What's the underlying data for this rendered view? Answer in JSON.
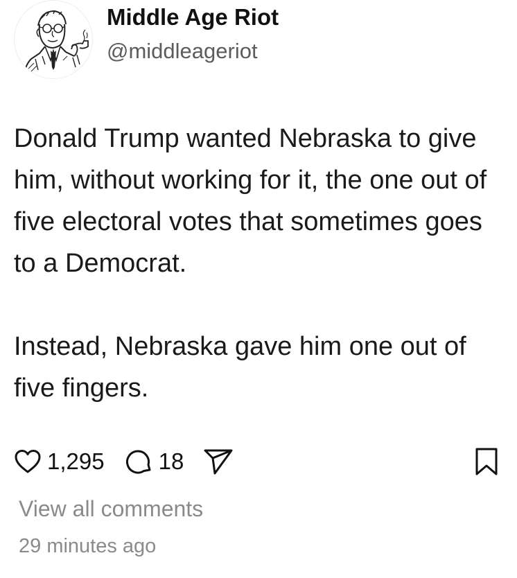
{
  "author": {
    "display_name": "Middle Age Riot",
    "handle": "@middleageriot",
    "avatar_icon": "vintage-man-with-pipe-illustration"
  },
  "post": {
    "paragraphs": [
      "Donald Trump wanted Nebraska to give him, without working for it, the one out of five electoral votes that sometimes goes to a Democrat.",
      "Instead, Nebraska gave him one out of five fingers."
    ]
  },
  "actions": {
    "likes": "1,295",
    "comments": "18",
    "like_icon": "heart-icon",
    "comment_icon": "comment-bubble-icon",
    "share_icon": "send-icon",
    "bookmark_icon": "bookmark-icon"
  },
  "footer": {
    "view_comments": "View all comments",
    "timestamp": "29 minutes ago"
  },
  "colors": {
    "text_primary": "#111111",
    "text_secondary": "#8a8a8a",
    "handle": "#5c5c5c"
  }
}
